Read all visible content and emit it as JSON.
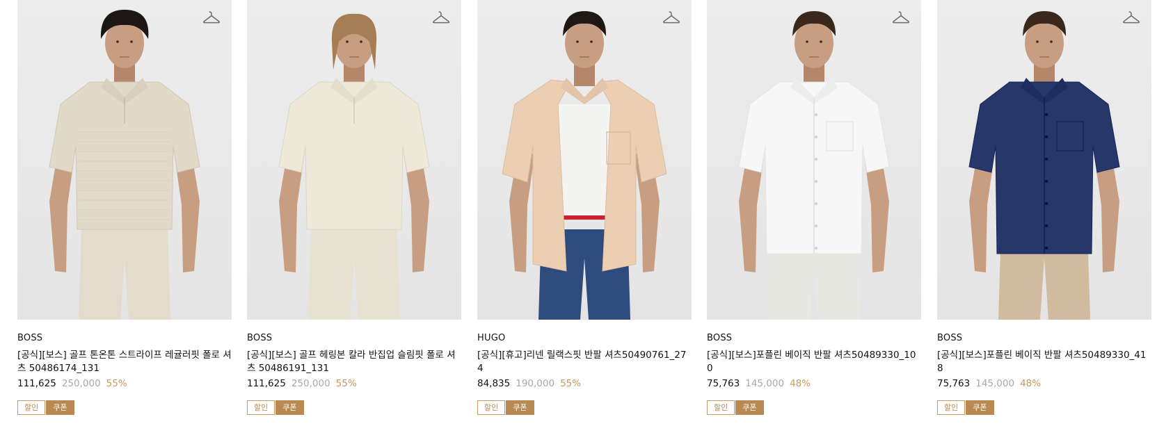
{
  "colors": {
    "discount": "#c59a5f",
    "badge_accent": "#b88a52",
    "original_price": "#a8a8a8"
  },
  "products": [
    {
      "brand": "BOSS",
      "title": "[공식][보스] 골프 톤온톤 스트라이프 레귤러핏 폴로 셔츠 50486174_131",
      "price": "111,625",
      "original_price": "250,000",
      "discount": "55%",
      "badges": [
        "할인",
        "쿠폰"
      ],
      "image": {
        "type": "polo-shirt",
        "shirt_color": "#e2d9c8",
        "pants_color": "#e3dccd",
        "hair_color": "#1c1714"
      }
    },
    {
      "brand": "BOSS",
      "title": "[공식][보스] 골프 헤링본 칼라 반집업 슬림핏 폴로 셔츠 50486191_131",
      "price": "111,625",
      "original_price": "250,000",
      "discount": "55%",
      "badges": [
        "할인",
        "쿠폰"
      ],
      "image": {
        "type": "polo-shirt",
        "shirt_color": "#ede8d8",
        "pants_color": "#e6e1d0",
        "hair_color": "#a57e55"
      }
    },
    {
      "brand": "HUGO",
      "title": "[공식][휴고]리넨 릴랙스핏 반팔 셔츠50490761_274",
      "price": "84,835",
      "original_price": "190,000",
      "discount": "55%",
      "badges": [
        "할인",
        "쿠폰"
      ],
      "image": {
        "type": "open-shirt",
        "shirt_color": "#eccfb2",
        "pants_color": "#2d4b7c",
        "hair_color": "#1e1714"
      }
    },
    {
      "brand": "BOSS",
      "title": "[공식][보스]포플린 베이직 반팔 셔츠50489330_100",
      "price": "75,763",
      "original_price": "145,000",
      "discount": "48%",
      "badges": [
        "할인",
        "쿠폰"
      ],
      "image": {
        "type": "button-shirt",
        "shirt_color": "#f7f7f7",
        "pants_color": "#e8e8e2",
        "hair_color": "#3a281c"
      }
    },
    {
      "brand": "BOSS",
      "title": "[공식][보스]포플린 베이직 반팔 셔츠50489330_418",
      "price": "75,763",
      "original_price": "145,000",
      "discount": "48%",
      "badges": [
        "할인",
        "쿠폰"
      ],
      "image": {
        "type": "button-shirt",
        "shirt_color": "#283769",
        "pants_color": "#d1bb9f",
        "hair_color": "#3a281c"
      }
    }
  ]
}
